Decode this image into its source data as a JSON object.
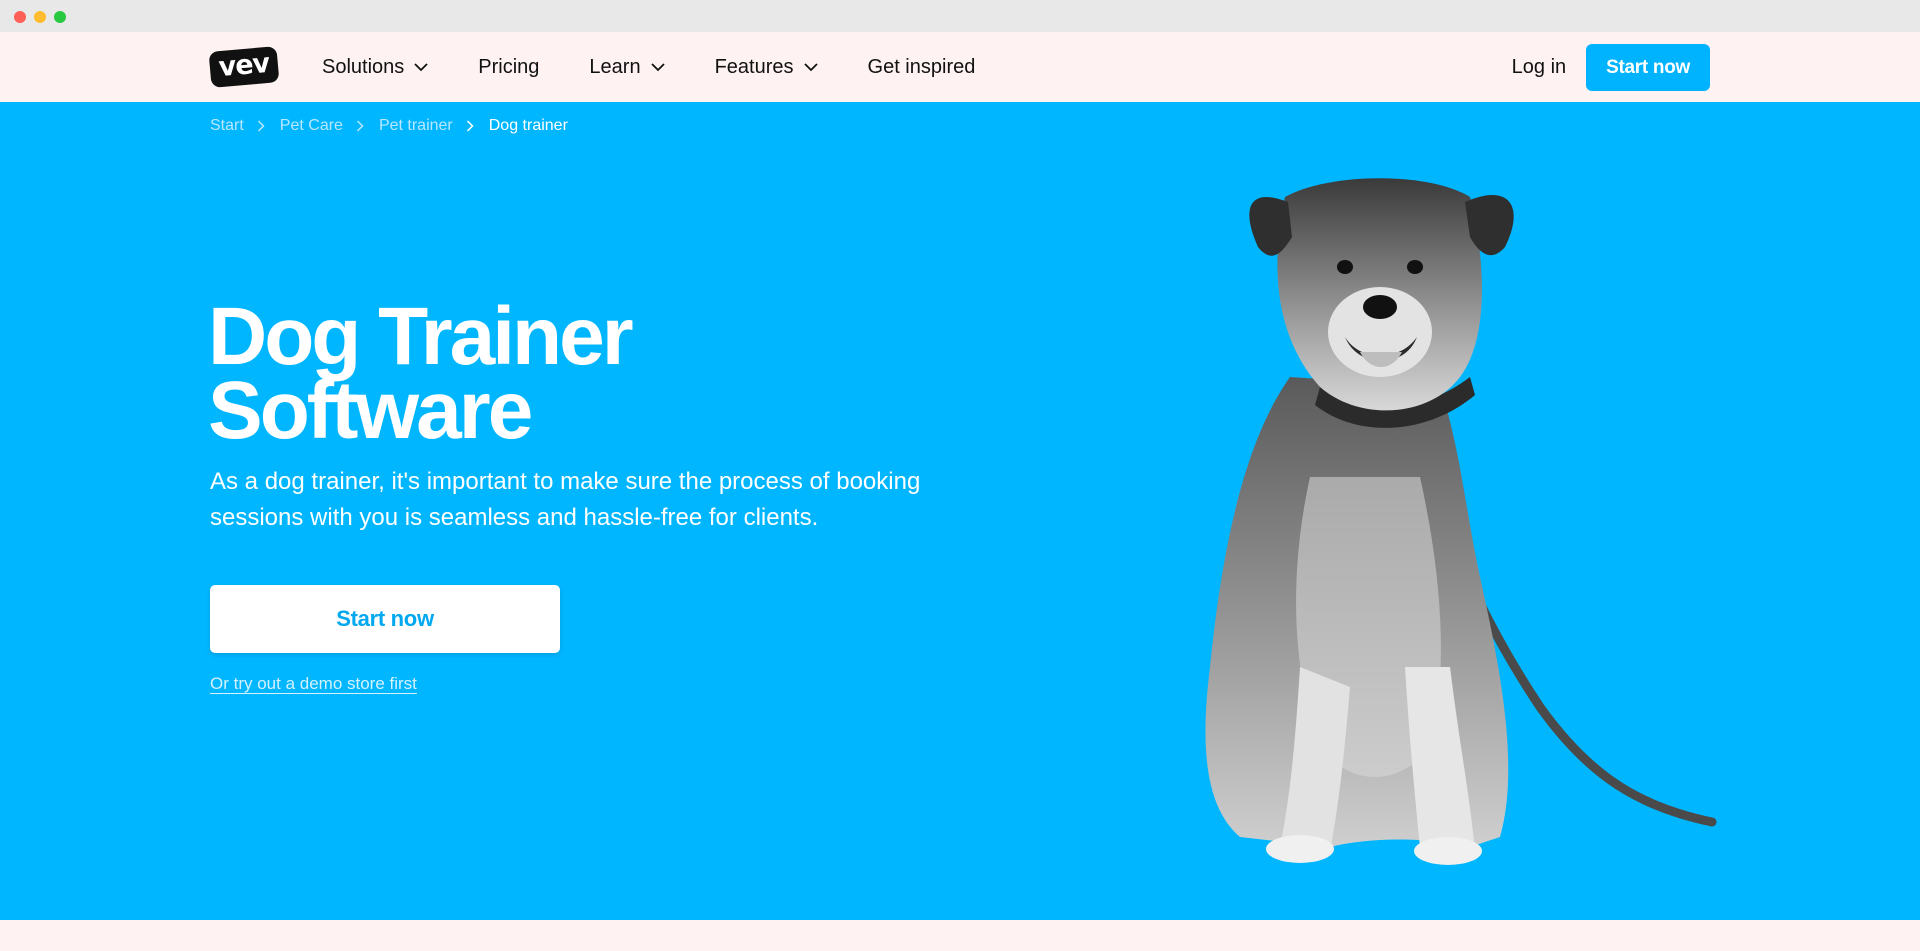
{
  "header": {
    "logo_text": "vev",
    "nav": [
      {
        "label": "Solutions",
        "has_dropdown": true,
        "icon": "chevron-down-icon"
      },
      {
        "label": "Pricing",
        "has_dropdown": false
      },
      {
        "label": "Learn",
        "has_dropdown": true,
        "icon": "chevron-down-icon"
      },
      {
        "label": "Features",
        "has_dropdown": true,
        "icon": "chevron-down-icon"
      },
      {
        "label": "Get inspired",
        "has_dropdown": false
      }
    ],
    "login_label": "Log in",
    "start_label": "Start now"
  },
  "breadcrumb": [
    "Start",
    "Pet Care",
    "Pet trainer",
    "Dog trainer"
  ],
  "hero": {
    "title_line1": "Dog Trainer",
    "title_line2": "Software",
    "subtitle": "As a dog trainer, it's important to make sure the process of booking sessions with you is seamless and hassle-free for clients.",
    "cta_label": "Start now",
    "demo_link": "Or try out a demo store first"
  },
  "colors": {
    "brand_blue": "#00b6ff",
    "header_bg": "#fff2f2",
    "button_blue": "#00b3fe",
    "text_dark": "#111111"
  },
  "images": {
    "hero_image": "dog-on-leash-photo"
  }
}
